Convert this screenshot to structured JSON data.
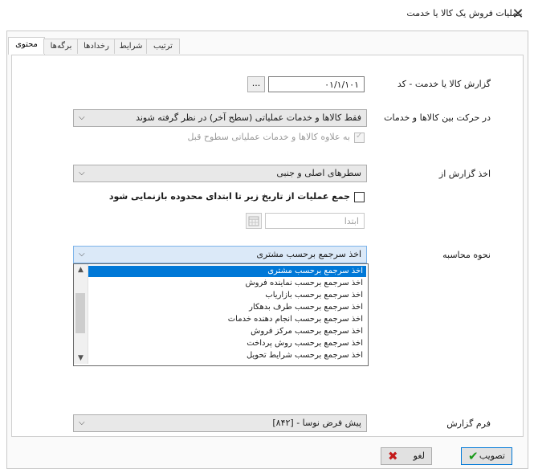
{
  "window": {
    "title": "عملیات فروش یک کالا یا خدمت",
    "close_glyph": "✕"
  },
  "tabs": [
    "محتوی",
    "برگه‌ها",
    "رخدادها",
    "شرایط",
    "ترتیب"
  ],
  "active_tab": "محتوی",
  "report": {
    "label": "گزارش کالا یا خدمت - کد",
    "code_value": "۰۱/۱/۱۰۱",
    "browse_label": "..."
  },
  "movement": {
    "label": "در حرکت بین کالاها و خدمات",
    "value": "فقط کالاها و خدمات عملیاتی (سطح آخر) در نظر گرفته شوند"
  },
  "include_upper": {
    "label": "به علاوه کالاها و خدمات عملیاتی سطوح قبل",
    "checked": true,
    "enabled": false
  },
  "report_from": {
    "label": "اخذ گزارش از",
    "value": "سطرهای اصلی و جنبی"
  },
  "sum_ops": {
    "label": "جمع عملیات از تاریخ زیر تا ابتدای محدوده بازنمایی شود",
    "checked": false
  },
  "start_date": {
    "placeholder": "ابتدا"
  },
  "calc_method": {
    "label": "نحوه محاسبه",
    "value": "اخذ سرجمع برحسب مشتری",
    "options": [
      "اخذ سرجمع برحسب مشتری",
      "اخذ سرجمع برحسب نماینده فروش",
      "اخذ سرجمع برحسب بازاریاب",
      "اخذ سرجمع برحسب طرف بدهکار",
      "اخذ سرجمع برحسب انجام دهنده خدمات",
      "اخذ سرجمع برحسب مرکز فروش",
      "اخذ سرجمع برحسب روش پرداخت",
      "اخذ سرجمع برحسب شرایط تحویل"
    ],
    "selected_index": 0
  },
  "report_form": {
    "label": "فرم گزارش",
    "value": "پیش فرض نوسا - [۸۴۲]"
  },
  "buttons": {
    "ok": "تصویب",
    "cancel": "لغو"
  },
  "colors": {
    "selection": "#0078d7",
    "ok_icon": "#1a9a1a",
    "cancel_icon": "#c41a1a"
  }
}
